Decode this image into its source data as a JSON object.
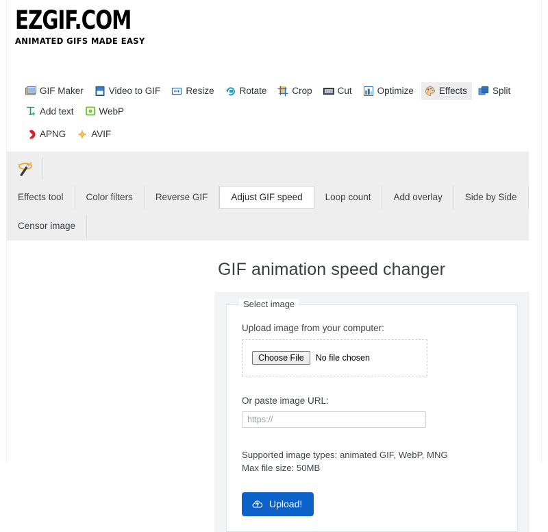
{
  "logo": {
    "title": "EZGIF.COM",
    "tagline": "ANIMATED GIFS MADE EASY"
  },
  "main_nav": {
    "items": [
      {
        "label": "GIF Maker",
        "icon": "gif-maker-icon",
        "active": false
      },
      {
        "label": "Video to GIF",
        "icon": "video-to-gif-icon",
        "active": false
      },
      {
        "label": "Resize",
        "icon": "resize-icon",
        "active": false
      },
      {
        "label": "Rotate",
        "icon": "rotate-icon",
        "active": false
      },
      {
        "label": "Crop",
        "icon": "crop-icon",
        "active": false
      },
      {
        "label": "Cut",
        "icon": "cut-icon",
        "active": false
      },
      {
        "label": "Optimize",
        "icon": "optimize-icon",
        "active": false
      },
      {
        "label": "Effects",
        "icon": "effects-icon",
        "active": true
      },
      {
        "label": "Split",
        "icon": "split-icon",
        "active": false
      },
      {
        "label": "Add text",
        "icon": "add-text-icon",
        "active": false
      },
      {
        "label": "WebP",
        "icon": "webp-icon",
        "active": false
      },
      {
        "label": "APNG",
        "icon": "apng-icon",
        "active": false
      },
      {
        "label": "AVIF",
        "icon": "avif-icon",
        "active": false
      }
    ]
  },
  "sub_nav": {
    "icon": "magic-wand-icon",
    "tabs": [
      {
        "label": "Effects tool",
        "active": false
      },
      {
        "label": "Color filters",
        "active": false
      },
      {
        "label": "Reverse GIF",
        "active": false
      },
      {
        "label": "Adjust GIF speed",
        "active": true
      },
      {
        "label": "Loop count",
        "active": false
      },
      {
        "label": "Add overlay",
        "active": false
      },
      {
        "label": "Side by Side",
        "active": false
      },
      {
        "label": "Censor image",
        "active": false
      }
    ]
  },
  "main": {
    "page_title": "GIF animation speed changer",
    "form": {
      "legend": "Select image",
      "upload_label": "Upload image from your computer:",
      "choose_file_button": "Choose File",
      "file_status": "No file chosen",
      "url_label": "Or paste image URL:",
      "url_value": "",
      "url_placeholder": "https://",
      "supported_types": "Supported image types: animated GIF, WebP, MNG",
      "max_size": "Max file size: 50MB",
      "upload_button": "Upload!",
      "upload_icon": "cloud-upload-icon"
    }
  },
  "colors": {
    "accent_blue": "#0d62ca",
    "subnav_bg": "#eeeeee",
    "panel_bg": "#f2f3f5",
    "active_tab_bg": "#ececec"
  }
}
